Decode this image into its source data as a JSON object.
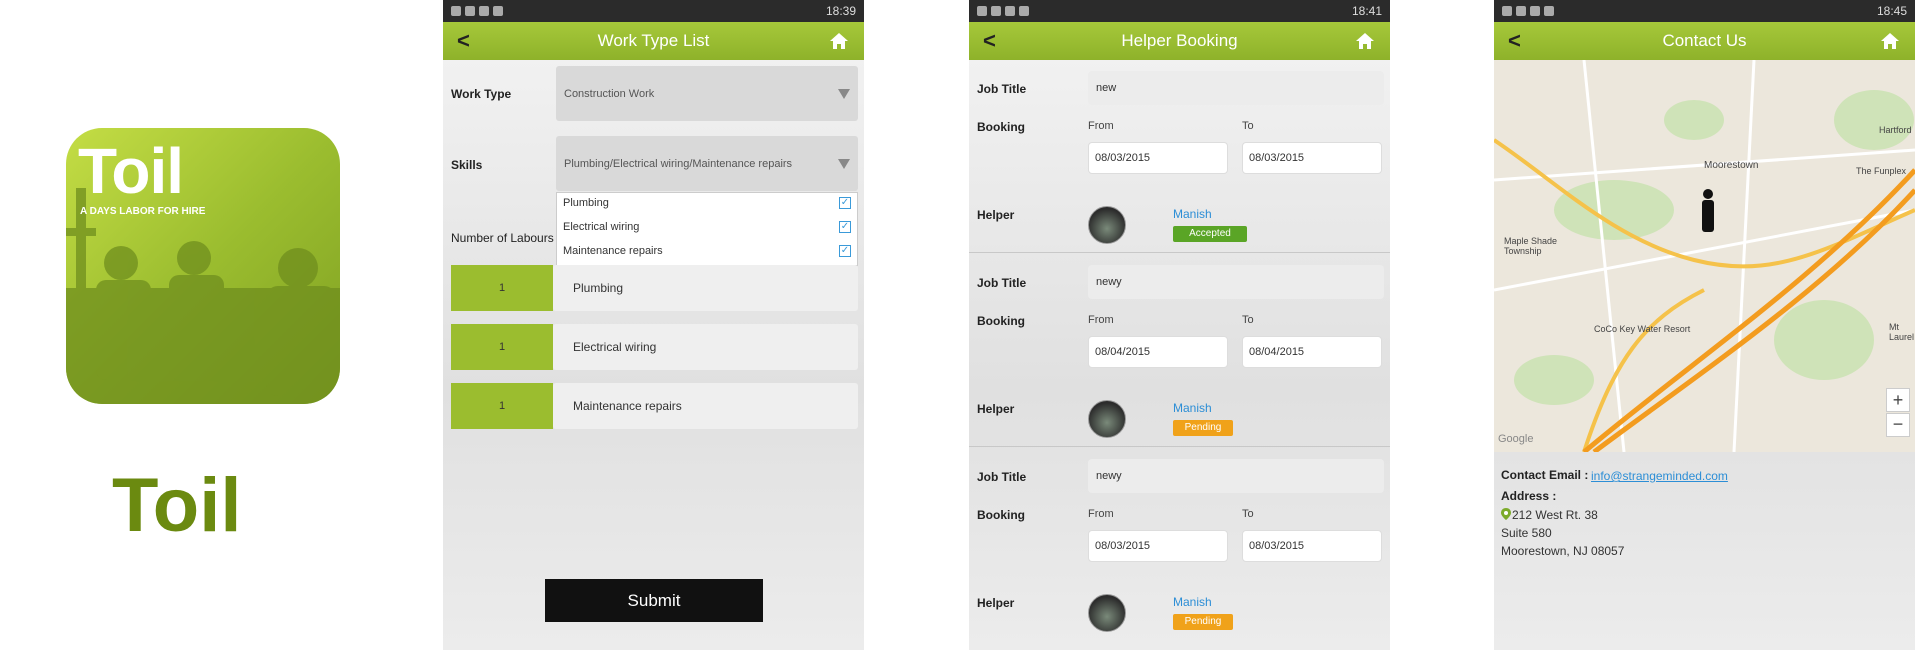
{
  "logo": {
    "title": "Toil",
    "tagline": "A DAYS LABOR FOR HIRE",
    "app_name": "Toil"
  },
  "status_bar": {
    "t1": "18:39",
    "t2": "18:41",
    "t3": "18:45"
  },
  "work_type_screen": {
    "title": "Work Type List",
    "work_type_label": "Work Type",
    "work_type_value": "Construction Work",
    "skills_label": "Skills",
    "skills_value": "Plumbing/Electrical wiring/Maintenance repairs",
    "skill_options": [
      "Plumbing",
      "Electrical wiring",
      "Maintenance repairs"
    ],
    "labours_label": "Number of Labours",
    "labours": [
      {
        "count": "1",
        "name": "Plumbing"
      },
      {
        "count": "1",
        "name": "Electrical wiring"
      },
      {
        "count": "1",
        "name": "Maintenance repairs"
      }
    ],
    "submit_label": "Submit"
  },
  "booking_screen": {
    "title": "Helper Booking",
    "job_title_label": "Job Title",
    "booking_label": "Booking",
    "from_label": "From",
    "to_label": "To",
    "helper_label": "Helper",
    "bookings": [
      {
        "job": "new",
        "from": "08/03/2015",
        "to": "08/03/2015",
        "helper": "Manish",
        "status": "Accepted"
      },
      {
        "job": "newy",
        "from": "08/04/2015",
        "to": "08/04/2015",
        "helper": "Manish",
        "status": "Pending"
      },
      {
        "job": "newy",
        "from": "08/03/2015",
        "to": "08/03/2015",
        "helper": "Manish",
        "status": "Pending"
      }
    ]
  },
  "contact_screen": {
    "title": "Contact Us",
    "map_labels": [
      "Moorestown",
      "Maple Shade Township",
      "CoCo Key Water Resort",
      "Hartford",
      "The Funplex",
      "Mt Laurel",
      "Google"
    ],
    "email_label": "Contact Email :",
    "email": "info@strangeminded.com",
    "address_label": "Address :",
    "address_lines": [
      "212 West Rt. 38",
      "Suite 580",
      "Moorestown, NJ 08057"
    ]
  },
  "colors": {
    "brand": "#9bbd2f",
    "accepted": "#5aa526",
    "pending": "#f0a21a"
  }
}
